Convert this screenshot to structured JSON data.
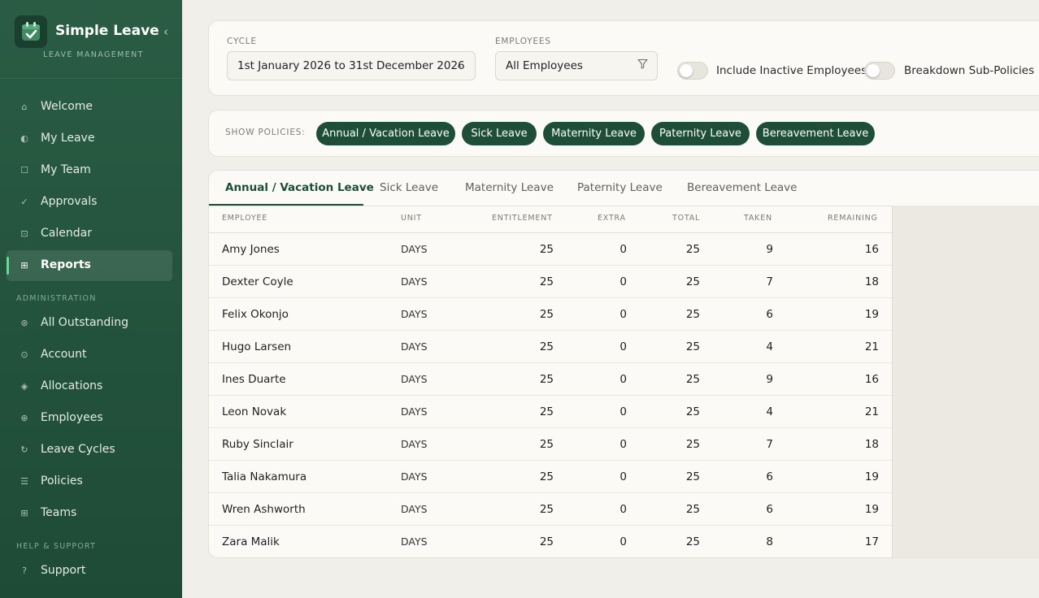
{
  "app": {
    "title": "Simple Leave",
    "subtitle": "LEAVE MANAGEMENT",
    "collapse_icon": "chevron-left-icon"
  },
  "sidebar": {
    "items": [
      {
        "label": "Welcome",
        "icon": "home-icon",
        "glyph": "⌂"
      },
      {
        "label": "My Leave",
        "icon": "half-circle-icon",
        "glyph": "◐"
      },
      {
        "label": "My Team",
        "icon": "square-icon",
        "glyph": "☐"
      },
      {
        "label": "Approvals",
        "icon": "check-icon",
        "glyph": "✓"
      },
      {
        "label": "Calendar",
        "icon": "calendar-icon",
        "glyph": "⊡"
      },
      {
        "label": "Reports",
        "icon": "grid-icon",
        "glyph": "⊞",
        "active": true
      }
    ],
    "admin_label": "ADMINISTRATION",
    "admin_items": [
      {
        "label": "All Outstanding",
        "icon": "target-icon",
        "glyph": "⊛"
      },
      {
        "label": "Account",
        "icon": "user-circle-icon",
        "glyph": "⊙"
      },
      {
        "label": "Allocations",
        "icon": "diamond-icon",
        "glyph": "◈"
      },
      {
        "label": "Employees",
        "icon": "plus-circle-icon",
        "glyph": "⊕"
      },
      {
        "label": "Leave Cycles",
        "icon": "refresh-icon",
        "glyph": "↻"
      },
      {
        "label": "Policies",
        "icon": "list-icon",
        "glyph": "☰"
      },
      {
        "label": "Teams",
        "icon": "teams-grid-icon",
        "glyph": "⊞"
      }
    ],
    "help_label": "HELP & SUPPORT",
    "help_items": [
      {
        "label": "Support",
        "icon": "question-icon",
        "glyph": "?"
      }
    ]
  },
  "filters": {
    "cycle_label": "CYCLE",
    "cycle_value": "1st January 2026 to 31st December 2026",
    "employees_label": "EMPLOYEES",
    "employees_value": "All Employees",
    "include_inactive_label": "Include Inactive Employees",
    "include_inactive_on": false,
    "breakdown_label": "Breakdown Sub-Policies",
    "breakdown_on": false
  },
  "policies": {
    "label": "SHOW POLICIES:",
    "chips": [
      "Annual / Vacation Leave",
      "Sick Leave",
      "Maternity Leave",
      "Paternity Leave",
      "Bereavement Leave"
    ]
  },
  "tabs": [
    "Annual / Vacation Leave",
    "Sick Leave",
    "Maternity Leave",
    "Paternity Leave",
    "Bereavement Leave"
  ],
  "table": {
    "columns": [
      "EMPLOYEE",
      "UNIT",
      "ENTITLEMENT",
      "EXTRA",
      "TOTAL",
      "TAKEN",
      "REMAINING"
    ],
    "rows": [
      {
        "employee": "Amy Jones",
        "unit": "DAYS",
        "entitlement": "25",
        "extra": "0",
        "total": "25",
        "taken": "9",
        "remaining": "16"
      },
      {
        "employee": "Dexter Coyle",
        "unit": "DAYS",
        "entitlement": "25",
        "extra": "0",
        "total": "25",
        "taken": "7",
        "remaining": "18"
      },
      {
        "employee": "Felix Okonjo",
        "unit": "DAYS",
        "entitlement": "25",
        "extra": "0",
        "total": "25",
        "taken": "6",
        "remaining": "19"
      },
      {
        "employee": "Hugo Larsen",
        "unit": "DAYS",
        "entitlement": "25",
        "extra": "0",
        "total": "25",
        "taken": "4",
        "remaining": "21"
      },
      {
        "employee": "Ines Duarte",
        "unit": "DAYS",
        "entitlement": "25",
        "extra": "0",
        "total": "25",
        "taken": "9",
        "remaining": "16"
      },
      {
        "employee": "Leon Novak",
        "unit": "DAYS",
        "entitlement": "25",
        "extra": "0",
        "total": "25",
        "taken": "4",
        "remaining": "21"
      },
      {
        "employee": "Ruby Sinclair",
        "unit": "DAYS",
        "entitlement": "25",
        "extra": "0",
        "total": "25",
        "taken": "7",
        "remaining": "18"
      },
      {
        "employee": "Talia Nakamura",
        "unit": "DAYS",
        "entitlement": "25",
        "extra": "0",
        "total": "25",
        "taken": "6",
        "remaining": "19"
      },
      {
        "employee": "Wren Ashworth",
        "unit": "DAYS",
        "entitlement": "25",
        "extra": "0",
        "total": "25",
        "taken": "6",
        "remaining": "19"
      },
      {
        "employee": "Zara Malik",
        "unit": "DAYS",
        "entitlement": "25",
        "extra": "0",
        "total": "25",
        "taken": "8",
        "remaining": "17"
      }
    ]
  },
  "colors": {
    "brand_green": "#1f4e38",
    "sidebar_green": "#2a5c44",
    "active_accent": "#6fd39a"
  }
}
